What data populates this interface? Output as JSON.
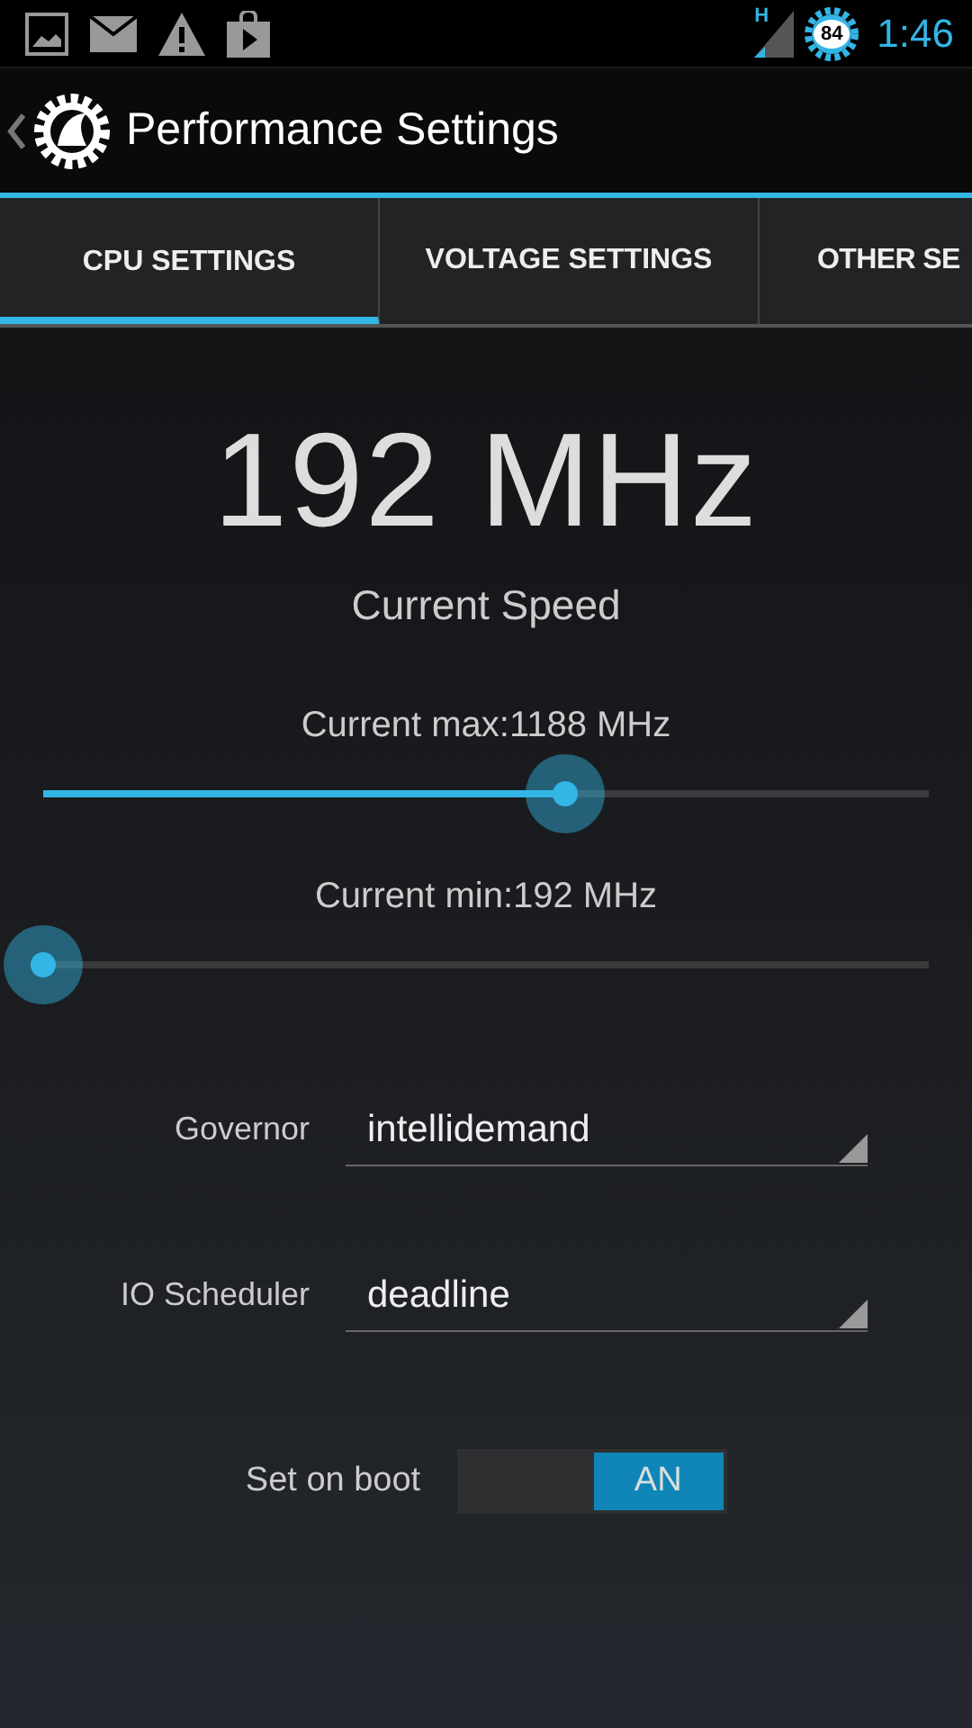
{
  "status_bar": {
    "network": "H",
    "battery": "84",
    "time": "1:46"
  },
  "action_bar": {
    "title": "Performance Settings"
  },
  "tabs": [
    {
      "label": "CPU SETTINGS",
      "selected": true
    },
    {
      "label": "VOLTAGE SETTINGS",
      "selected": false
    },
    {
      "label": "OTHER SE",
      "selected": false
    }
  ],
  "current_speed": {
    "value": "192 MHz",
    "label": "Current Speed"
  },
  "sliders": [
    {
      "label": "Current max:1188 MHz",
      "level": 0.59
    },
    {
      "label": "Current min:192 MHz",
      "level": 0
    }
  ],
  "dropdowns": [
    {
      "label": "Governor",
      "value": "intellidemand"
    },
    {
      "label": "IO Scheduler",
      "value": "deadline"
    }
  ],
  "set_on_boot": {
    "label": "Set on boot",
    "on": true,
    "state_text": "AN"
  }
}
